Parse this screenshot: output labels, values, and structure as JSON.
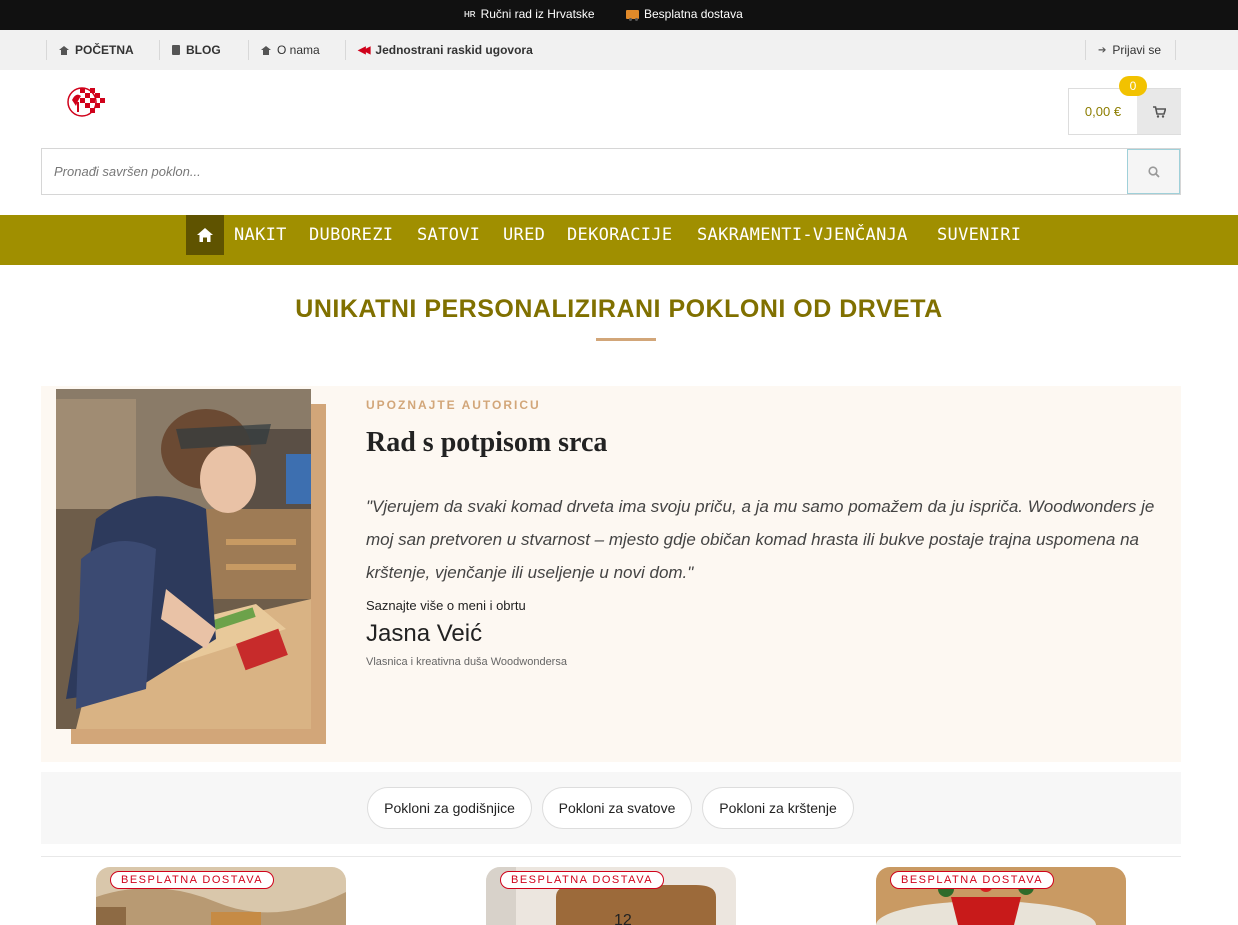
{
  "topbar": {
    "flag_code": "HR",
    "handmade": "Ručni rad iz Hrvatske",
    "shipping": "Besplatna dostava"
  },
  "subnav": {
    "home": "POČETNA",
    "blog": "BLOG",
    "about": "O nama",
    "contract": "Jednostrani raskid ugovora",
    "login": "Prijavi se"
  },
  "cart": {
    "total": "0,00 €",
    "count": "0"
  },
  "search": {
    "placeholder": "Pronađi savršen poklon..."
  },
  "menu": {
    "items": [
      "NAKIT",
      "DUBOREZI",
      "SATOVI",
      "URED",
      "DEKORACIJE",
      "SAKRAMENTI-VJENČANJA",
      "SUVENIRI"
    ]
  },
  "page": {
    "heading": "UNIKATNI PERSONALIZIRANI POKLONI OD DRVETA"
  },
  "author": {
    "kicker": "UPOZNAJTE AUTORICU",
    "title": "Rad s potpisom srca",
    "quote": "\"Vjerujem da svaki komad drveta ima svoju priču, a ja mu samo pomažem da ju ispriča. Woodwonders je moj san pretvoren u stvarnost – mjesto gdje običan komad hrasta ili bukve postaje trajna uspomena na krštenje, vjenčanje ili useljenje u novi dom.\"",
    "more": "Saznajte više o meni i obrtu",
    "name": "Jasna Veić",
    "role": "Vlasnica i kreativna duša Woodwondersa"
  },
  "categories": [
    "Pokloni za godišnjice",
    "Pokloni za svatove",
    "Pokloni za krštenje"
  ],
  "products": [
    {
      "badge": "BESPLATNA DOSTAVA"
    },
    {
      "badge": "BESPLATNA DOSTAVA"
    },
    {
      "badge": "BESPLATNA DOSTAVA"
    }
  ],
  "colors": {
    "menu_bg": "#a08f00",
    "accent": "#d2a679",
    "heading": "#807000",
    "badge_red": "#d0021b",
    "cart_badge": "#f2c200"
  }
}
